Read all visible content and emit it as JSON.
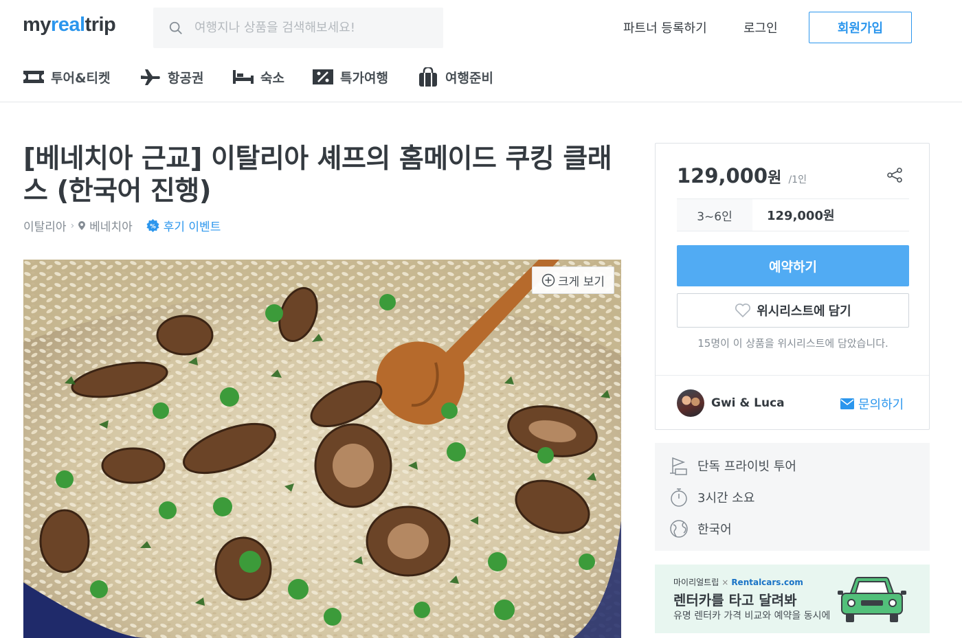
{
  "header": {
    "logo_prefix": "my",
    "logo_accent": "real",
    "logo_suffix": "trip",
    "search_placeholder": "여행지나 상품을 검색해보세요!",
    "partner_link": "파트너 등록하기",
    "login_link": "로그인",
    "signup_button": "회원가입"
  },
  "categories": [
    {
      "label": "투어&티켓",
      "icon": "ticket-icon"
    },
    {
      "label": "항공권",
      "icon": "airplane-icon"
    },
    {
      "label": "숙소",
      "icon": "bed-icon"
    },
    {
      "label": "특가여행",
      "icon": "discount-icon"
    },
    {
      "label": "여행준비",
      "icon": "bag-icon"
    }
  ],
  "product": {
    "title": "[베네치아 근교] 이탈리아 셰프의 홈메이드 쿠킹 클래스 (한국어 진행)",
    "breadcrumb_country": "이탈리아",
    "breadcrumb_city": "베네치아",
    "event_label": "후기 이벤트",
    "zoom_label": "크게 보기"
  },
  "booking": {
    "price": "129,000",
    "currency": "원",
    "per_unit": "/1인",
    "tier_people": "3~6인",
    "tier_price": "129,000원",
    "book_button": "예약하기",
    "wishlist_button": "위시리스트에 담기",
    "wishlist_count_text": "15명이 이 상품을 위시리스트에 담았습니다.",
    "guide_name": "Gwi & Luca",
    "inquiry_button": "문의하기"
  },
  "info": {
    "tour_type": "단독 프라이빗 투어",
    "duration": "3시간 소요",
    "language": "한국어"
  },
  "banner": {
    "brand_left": "마이리얼트립",
    "cross": "×",
    "brand_right": "Rentalcars.com",
    "headline": "렌터카를 타고 달려봐",
    "subline": "유명 렌터카 가격 비교와 예약을 동시에"
  },
  "colors": {
    "accent": "#2b96ed",
    "book_button": "#51abf3",
    "banner_bg": "#e8f6f0",
    "car": "#52c07a"
  }
}
